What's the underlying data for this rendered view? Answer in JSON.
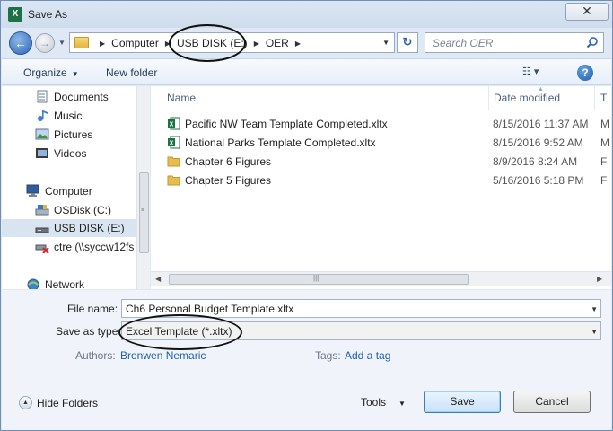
{
  "window": {
    "title": "Save As",
    "app_icon_letter": "X",
    "close_glyph": "✕"
  },
  "nav": {
    "back_glyph": "←",
    "forward_glyph": "→",
    "recent_glyph": "▼",
    "breadcrumb": [
      "Computer",
      "USB DISK (E:)",
      "OER"
    ],
    "refresh_glyph": "↻",
    "search_placeholder": "Search OER"
  },
  "toolbar": {
    "organize_label": "Organize",
    "new_folder_label": "New folder",
    "views_glyph": "☷ ▾",
    "help_glyph": "?"
  },
  "sidebar": {
    "items": [
      {
        "label": "Documents",
        "icon": "documents-icon"
      },
      {
        "label": "Music",
        "icon": "music-icon"
      },
      {
        "label": "Pictures",
        "icon": "pictures-icon"
      },
      {
        "label": "Videos",
        "icon": "videos-icon"
      },
      {
        "label": "Computer",
        "icon": "computer-icon"
      },
      {
        "label": "OSDisk (C:)",
        "icon": "disk-icon"
      },
      {
        "label": "USB DISK (E:)",
        "icon": "usb-drive-icon",
        "selected": true
      },
      {
        "label": "ctre (\\\\syccw12fs",
        "icon": "network-drive-icon"
      },
      {
        "label": "Network",
        "icon": "network-icon"
      }
    ]
  },
  "files": {
    "columns": [
      "Name",
      "Date modified",
      "T"
    ],
    "rows": [
      {
        "name": "Pacific NW Team Template Completed.xltx",
        "date": "8/15/2016 11:37 AM",
        "type": "M",
        "icon": "excel-template-icon"
      },
      {
        "name": "National Parks Template Completed.xltx",
        "date": "8/15/2016 9:52 AM",
        "type": "M",
        "icon": "excel-template-icon"
      },
      {
        "name": "Chapter 6 Figures",
        "date": "8/9/2016 8:24 AM",
        "type": "F",
        "icon": "folder-icon"
      },
      {
        "name": "Chapter 5 Figures",
        "date": "5/16/2016 5:18 PM",
        "type": "F",
        "icon": "folder-icon"
      }
    ]
  },
  "form": {
    "file_name_label": "File name:",
    "file_name_value": "Ch6 Personal Budget Template.xltx",
    "save_type_label": "Save as type:",
    "save_type_value": "Excel Template (*.xltx)",
    "authors_label": "Authors:",
    "authors_value": "Bronwen Nemaric",
    "tags_label": "Tags:",
    "tags_value": "Add a tag"
  },
  "footer": {
    "hide_folders_label": "Hide Folders",
    "tools_label": "Tools",
    "save_label": "Save",
    "cancel_label": "Cancel"
  },
  "colors": {
    "accent": "#2c64b4",
    "window_bg": "#dfe9f5",
    "link": "#1e5fb0",
    "annotation_oval": "#111111"
  }
}
